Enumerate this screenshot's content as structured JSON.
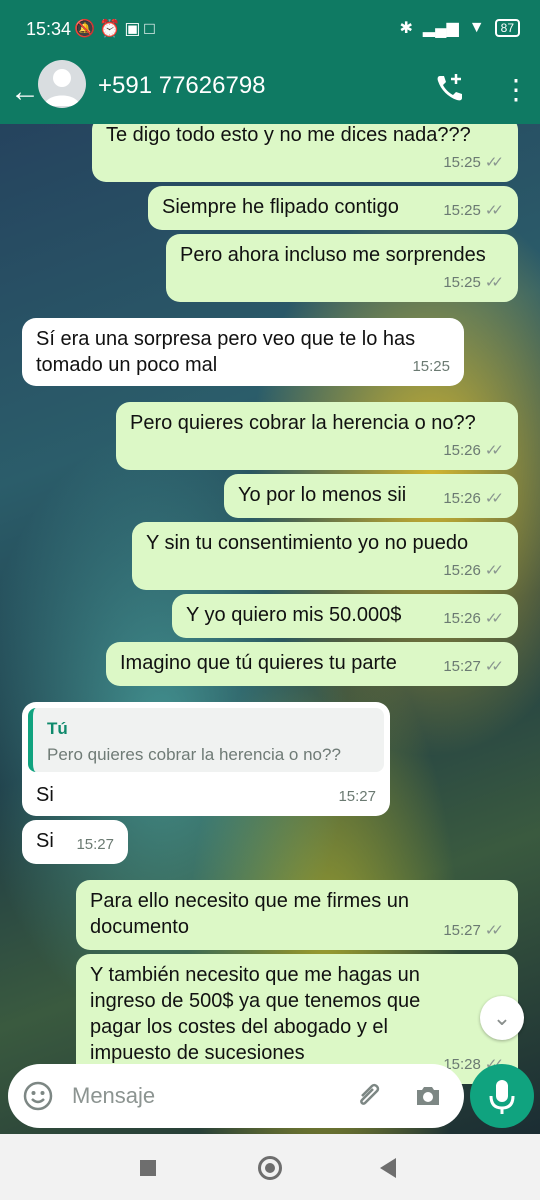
{
  "status_bar": {
    "time": "15:34",
    "battery": "87"
  },
  "header": {
    "contact": "+591 77626798"
  },
  "messages": [
    {
      "text": "Te digo todo esto y no me dices nada???",
      "time": "15:25",
      "dir": "out"
    },
    {
      "text": "Siempre he flipado contigo",
      "time": "15:25",
      "dir": "out"
    },
    {
      "text": "Pero ahora incluso me sorprendes",
      "time": "15:25",
      "dir": "out"
    },
    {
      "text_line1": "Sí era una sorpresa pero veo que te lo has",
      "text_line2": "tomado un poco mal",
      "time": "15:25",
      "dir": "in"
    },
    {
      "text": "Pero quieres cobrar la herencia o no??",
      "time": "15:26",
      "dir": "out"
    },
    {
      "text": "Yo por lo menos sii",
      "time": "15:26",
      "dir": "out"
    },
    {
      "text": "Y sin tu consentimiento yo no puedo",
      "time": "15:26",
      "dir": "out"
    },
    {
      "text": "Y yo quiero mis 50.000$",
      "time": "15:26",
      "dir": "out"
    },
    {
      "text": "Imagino que tú quieres tu parte",
      "time": "15:27",
      "dir": "out"
    },
    {
      "quote_name": "Tú",
      "quote_text": "Pero quieres cobrar la herencia o no??",
      "text": "Si",
      "time": "15:27",
      "dir": "in"
    },
    {
      "text": "Si",
      "time": "15:27",
      "dir": "in"
    },
    {
      "text_line1": "Para ello necesito que me firmes un",
      "text_line2": "documento",
      "time": "15:27",
      "dir": "out"
    },
    {
      "text_line1": "Y también necesito que me hagas un",
      "text_line2": "ingreso de 500$ ya que tenemos que",
      "text_line3": "pagar los costes del abogado y el",
      "text_line4": "impuesto de sucesiones",
      "time": "15:28",
      "dir": "out"
    }
  ],
  "composer": {
    "placeholder": "Mensaje"
  },
  "colors": {
    "header": "#0f7a63",
    "outgoing": "#dcf8c6",
    "incoming": "#ffffff",
    "accent": "#10a37f"
  },
  "icons": [
    "back-arrow-icon",
    "add-call-icon",
    "more-icon",
    "emoji-icon",
    "attach-icon",
    "camera-icon",
    "mic-icon",
    "chevron-down-icon"
  ]
}
